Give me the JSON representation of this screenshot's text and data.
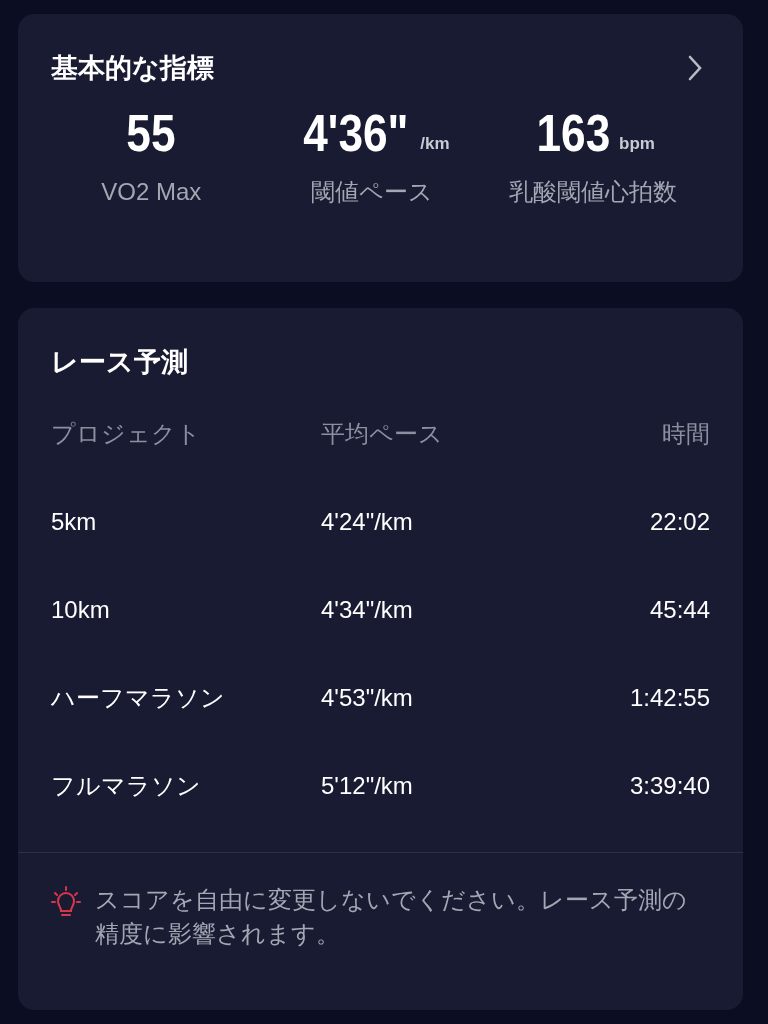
{
  "metrics_card": {
    "title": "基本的な指標",
    "metrics": [
      {
        "value": "55",
        "label": "VO2 Max"
      },
      {
        "value": "4'36\"",
        "unit": "/km",
        "label": "閾値ペース"
      },
      {
        "value": "163",
        "unit": "bpm",
        "label": "乳酸閾値心拍数"
      }
    ]
  },
  "race_card": {
    "title": "レース予測",
    "columns": [
      "プロジェクト",
      "平均ペース",
      "時間"
    ],
    "rows": [
      [
        "5km",
        "4'24\"/km",
        "22:02"
      ],
      [
        "10km",
        "4'34\"/km",
        "45:44"
      ],
      [
        "ハーフマラソン",
        "4'53\"/km",
        "1:42:55"
      ],
      [
        "フルマラソン",
        "5'12\"/km",
        "3:39:40"
      ]
    ],
    "note": "スコアを自由に変更しないでください。レース予測の精度に影響されます。"
  }
}
